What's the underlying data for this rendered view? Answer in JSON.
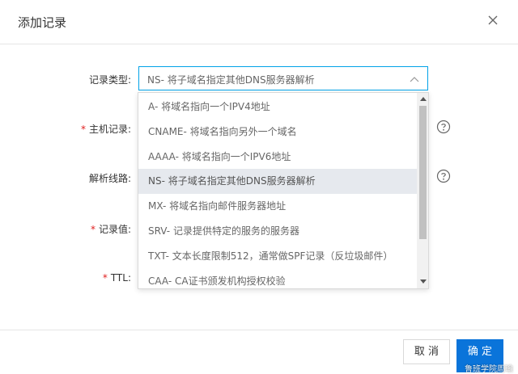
{
  "dialog": {
    "title": "添加记录"
  },
  "form": {
    "record_type": {
      "label": "记录类型:",
      "value": "NS- 将子域名指定其他DNS服务器解析"
    },
    "host_record": {
      "required": "*",
      "label": "主机记录:"
    },
    "resolve_line": {
      "label": "解析线路:"
    },
    "record_value": {
      "required": "*",
      "label": "记录值:"
    },
    "ttl": {
      "required": "*",
      "label": "TTL:"
    }
  },
  "dropdown": {
    "options": [
      "A- 将域名指向一个IPV4地址",
      "CNAME- 将域名指向另外一个域名",
      "AAAA- 将域名指向一个IPV6地址",
      "NS- 将子域名指定其他DNS服务器解析",
      "MX- 将域名指向邮件服务器地址",
      "SRV- 记录提供特定的服务的服务器",
      "TXT- 文本长度限制512，通常做SPF记录（反垃圾邮件）",
      "CAA- CA证书颁发机构授权校验"
    ],
    "selected_index": 3
  },
  "footer": {
    "cancel_label": "取 消",
    "ok_label": "确 定"
  },
  "watermark": "鲁班学院周瑜",
  "colors": {
    "accent": "#00a2e8",
    "primary_button": "#0a74da",
    "required": "#e02020",
    "selected_option_bg": "#e6e9ee"
  },
  "icons": {
    "close": "close-icon",
    "chevron": "chevron-up-icon",
    "help": "question-circle-icon"
  }
}
